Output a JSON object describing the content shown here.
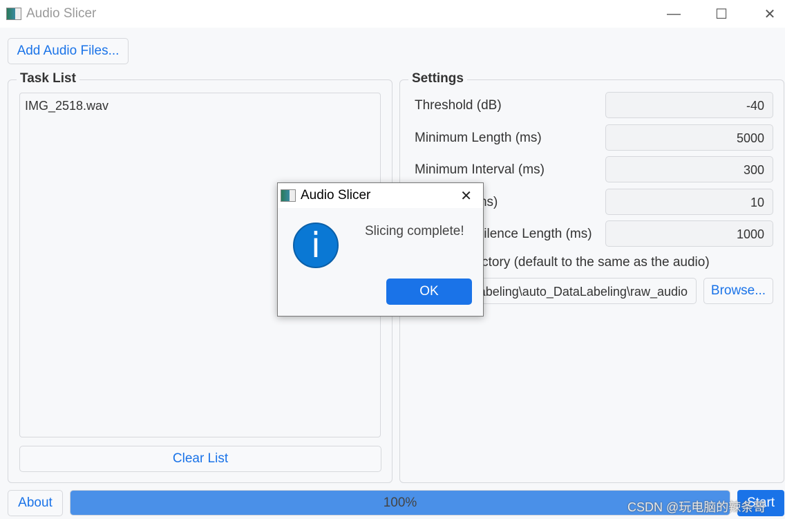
{
  "window": {
    "title": "Audio Slicer",
    "minimize": "—",
    "maximize": "☐",
    "close": "✕"
  },
  "toolbar": {
    "add_files": "Add Audio Files..."
  },
  "task_list": {
    "title": "Task List",
    "items": [
      "IMG_2518.wav"
    ],
    "clear": "Clear List"
  },
  "settings": {
    "title": "Settings",
    "fields": [
      {
        "label": "Threshold (dB)",
        "value": "-40"
      },
      {
        "label": "Minimum Length (ms)",
        "value": "5000"
      },
      {
        "label": "Minimum Interval (ms)",
        "value": "300"
      },
      {
        "label": "Hop Size (ms)",
        "value": "10"
      },
      {
        "label": "Maximum Silence Length (ms)",
        "value": "1000"
      }
    ],
    "output_label": "Output Directory (default to the same as the audio)",
    "output_value": "D:\\DataLabeling\\auto_DataLabeling\\raw_audio",
    "browse": "Browse..."
  },
  "footer": {
    "about": "About",
    "progress": "100%",
    "progress_value": 100,
    "start": "Start"
  },
  "watermark": "CSDN @玩电脑的辣条哥",
  "dialog": {
    "title": "Audio Slicer",
    "message": "Slicing complete!",
    "ok": "OK",
    "close": "✕",
    "icon": "info-icon"
  }
}
